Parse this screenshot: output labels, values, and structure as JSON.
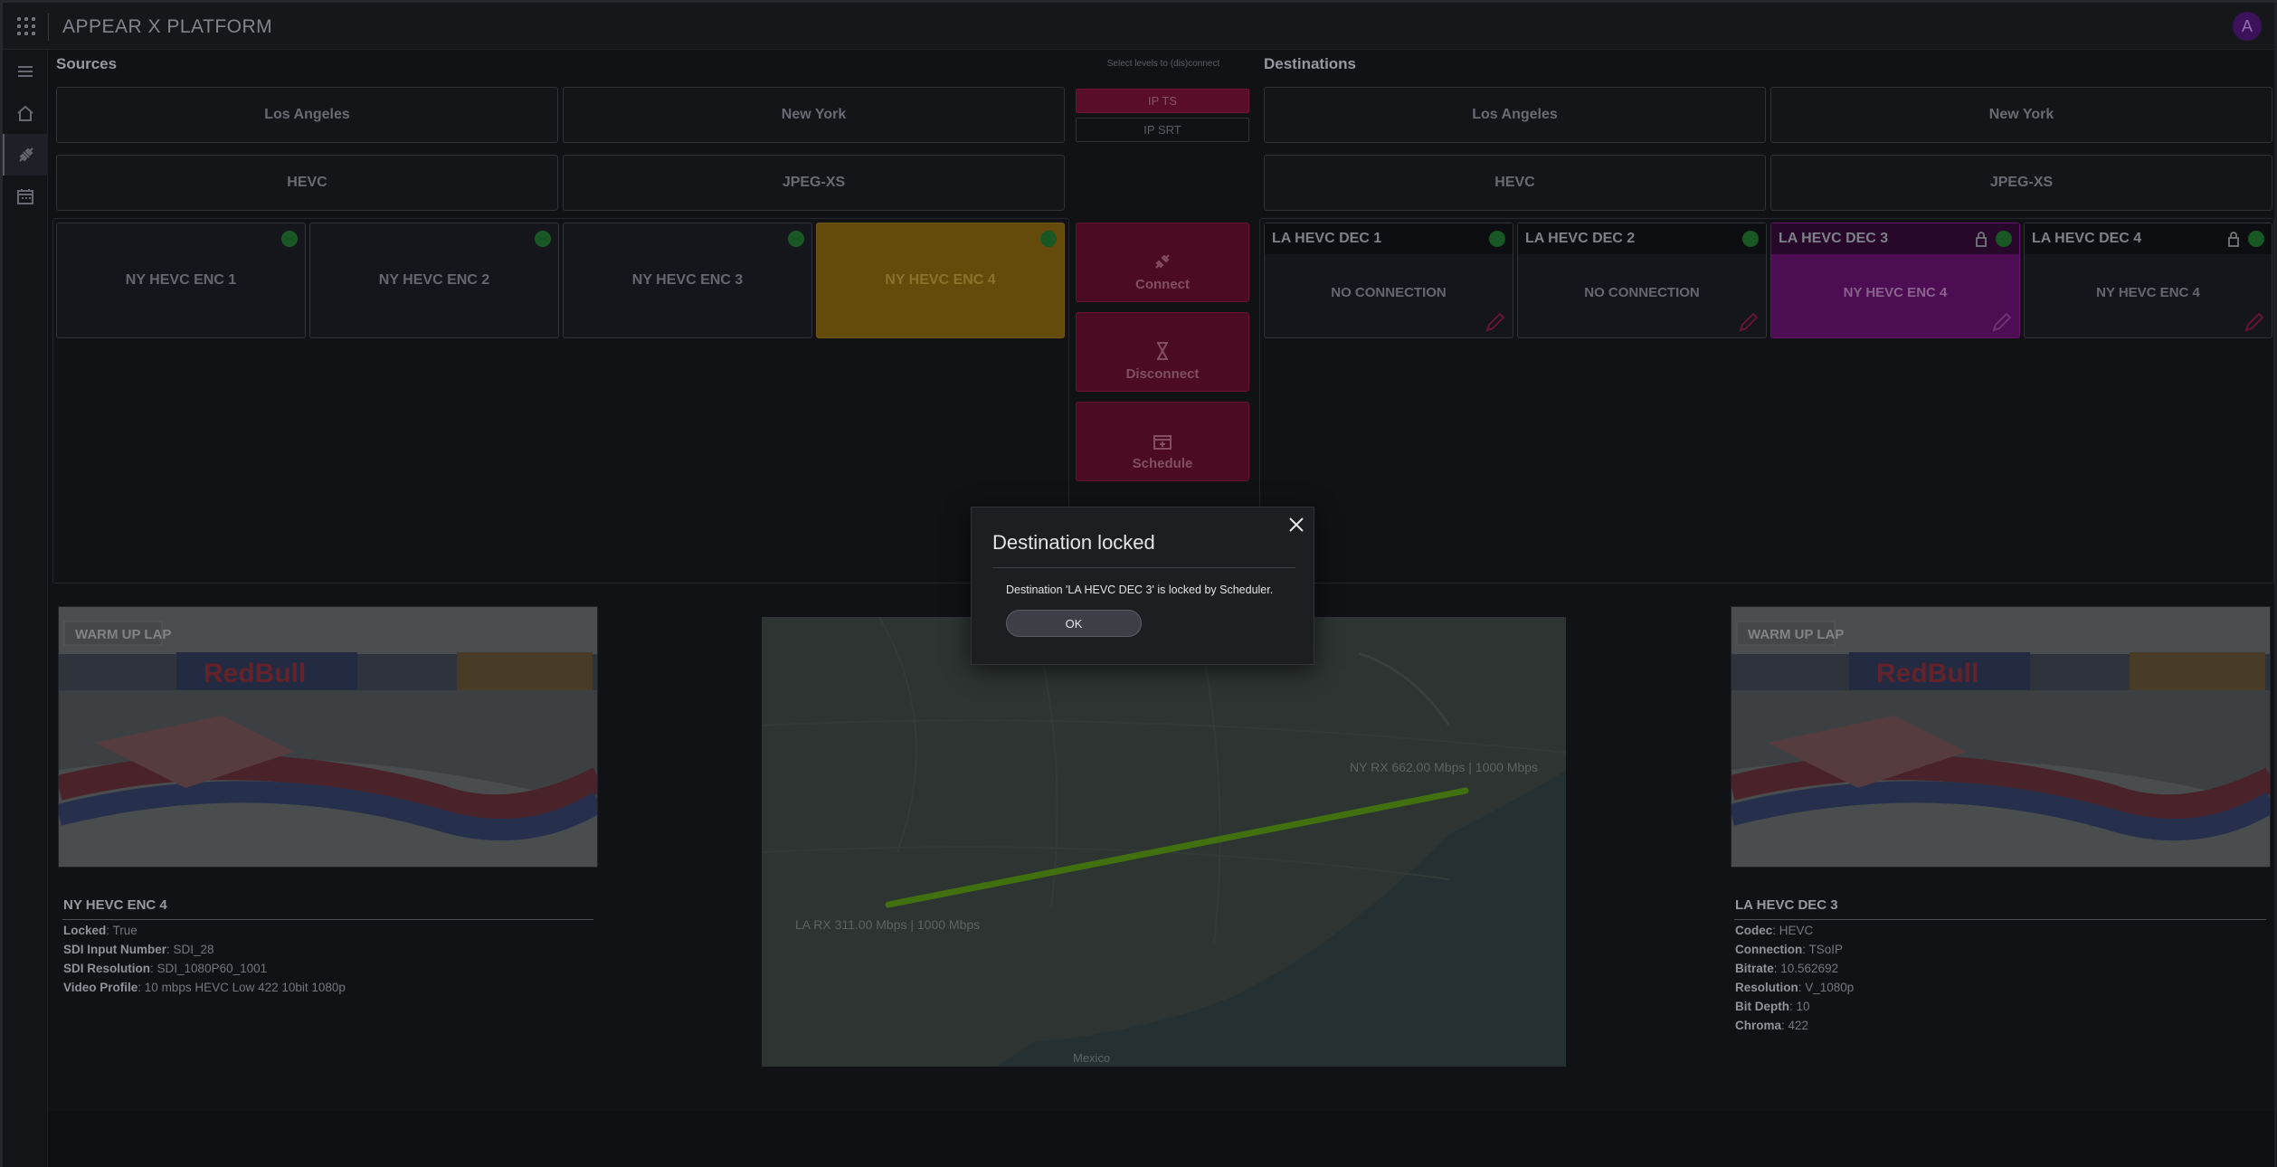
{
  "header": {
    "title": "APPEAR X PLATFORM",
    "avatar_initial": "A"
  },
  "sidebar": {
    "items": [
      "menu-icon",
      "home-icon",
      "connect-icon",
      "calendar-icon"
    ]
  },
  "sources": {
    "title": "Sources",
    "locations": [
      "Los Angeles",
      "New York"
    ],
    "codecs": [
      "HEVC",
      "JPEG-XS"
    ],
    "devices": [
      "NY HEVC ENC 1",
      "NY HEVC ENC 2",
      "NY HEVC ENC 3",
      "NY HEVC ENC 4"
    ]
  },
  "middle": {
    "levels_label": "Select levels to (dis)connect",
    "levels": [
      "IP TS",
      "IP SRT"
    ],
    "actions": [
      "Connect",
      "Disconnect",
      "Schedule"
    ]
  },
  "destinations": {
    "title": "Destinations",
    "locations": [
      "Los Angeles",
      "New York"
    ],
    "codecs": [
      "HEVC",
      "JPEG-XS"
    ],
    "devices": [
      {
        "name": "LA HEVC DEC 1",
        "status": "NO CONNECTION"
      },
      {
        "name": "LA HEVC DEC 2",
        "status": "NO CONNECTION"
      },
      {
        "name": "LA HEVC DEC 3",
        "status": "NY HEVC ENC 4"
      },
      {
        "name": "LA HEVC DEC 4",
        "status": "NY HEVC ENC 4"
      }
    ]
  },
  "thumbnail": {
    "overlay_text": "WARM UP LAP",
    "banner_text": "RedBull"
  },
  "source_info": {
    "title": "NY HEVC ENC 4",
    "rows": [
      {
        "label": "Locked",
        "value": "True"
      },
      {
        "label": "SDI Input Number",
        "value": "SDI_28"
      },
      {
        "label": "SDI Resolution",
        "value": "SDI_1080P60_1001"
      },
      {
        "label": "Video Profile",
        "value": "10 mbps HEVC Low 422 10bit 1080p"
      }
    ]
  },
  "dest_info": {
    "title": "LA HEVC DEC 3",
    "rows": [
      {
        "label": "Codec",
        "value": "HEVC"
      },
      {
        "label": "Connection",
        "value": "TSoIP"
      },
      {
        "label": "Bitrate",
        "value": "10.562692"
      },
      {
        "label": "Resolution",
        "value": "V_1080p"
      },
      {
        "label": "Bit Depth",
        "value": "10"
      },
      {
        "label": "Chroma",
        "value": "422"
      }
    ]
  },
  "map": {
    "ny_label": "NY RX 662.00 Mbps | 1000 Mbps",
    "la_label": "LA RX 311.00 Mbps | 1000 Mbps",
    "mexico_label": "Mexico",
    "link_color": "#4f8a12"
  },
  "modal": {
    "title": "Destination locked",
    "message": "Destination 'LA HEVC DEC 3' is locked by Scheduler.",
    "ok_label": "OK"
  }
}
